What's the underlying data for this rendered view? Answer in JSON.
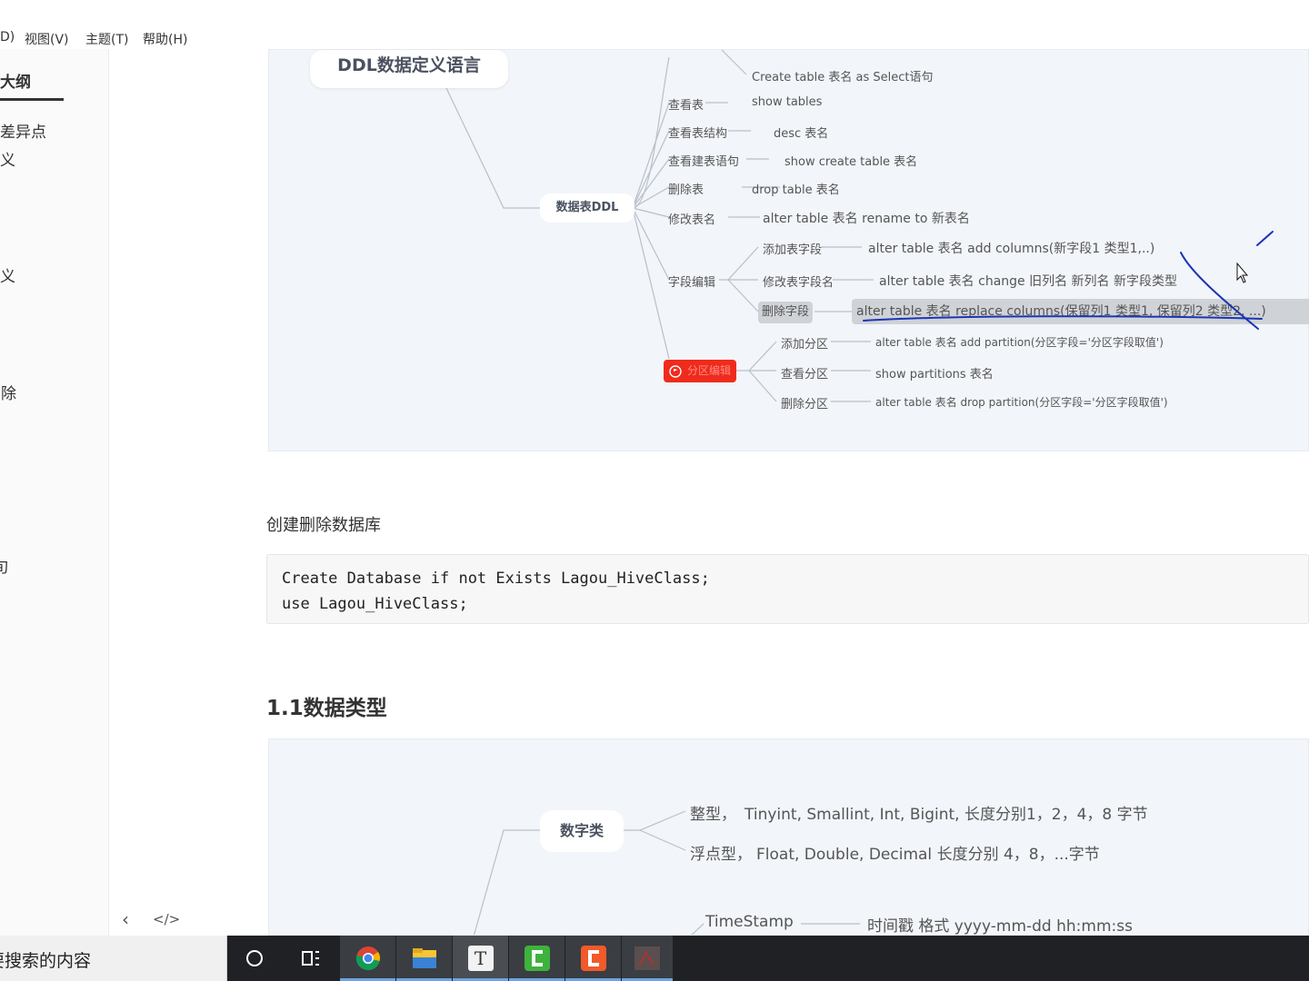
{
  "menu": {
    "items": [
      "D)",
      "视图(V)",
      "主题(T)",
      "帮助(H)"
    ]
  },
  "sidebar": {
    "outline_tab": "大纲",
    "items": [
      "差异点",
      "义",
      "定义",
      "删除",
      "旬"
    ],
    "prev_label": "‹",
    "source_label": "</>"
  },
  "search": {
    "placeholder": "要搜索的内容"
  },
  "taskbar": {
    "icons": [
      "cortana-icon",
      "task-view-icon",
      "chrome-icon",
      "file-explorer-icon",
      "typora-icon",
      "camtasia-green-icon",
      "camtasia-orange-icon",
      "app-thumbnail-icon"
    ],
    "typora_letter": "T"
  },
  "mindmap1": {
    "root": "DDL数据定义语言",
    "branch": "数据表DDL",
    "top_leaf": "Create table  表名  as  Select语句",
    "rows": [
      {
        "label": "查看表",
        "value": "show  tables"
      },
      {
        "label": "查看表结构",
        "value": "desc  表名"
      },
      {
        "label": "查看建表语句",
        "value": "show create table 表名"
      },
      {
        "label": "删除表",
        "value": "drop  table  表名"
      },
      {
        "label": "修改表名",
        "value": "alter table 表名 rename to 新表名"
      }
    ],
    "field_edit": {
      "label": "字段编辑",
      "children": [
        {
          "label": "添加表字段",
          "value": "alter table 表名 add  columns(新字段1  类型1,..)"
        },
        {
          "label": "修改表字段名",
          "value": "alter table 表名 change 旧列名  新列名 新字段类型"
        },
        {
          "label": "删除字段",
          "value": "alter table   表名  replace columns(保留列1 类型1,   保留列2 类型2,   ...)"
        }
      ]
    },
    "partition": {
      "label": "分区编辑",
      "children": [
        {
          "label": "添加分区",
          "value": "alter table 表名 add  partition(分区字段='分区字段取值')"
        },
        {
          "label": "查看分区",
          "value": "show partitions  表名"
        },
        {
          "label": "删除分区",
          "value": "alter table 表名 drop  partition(分区字段='分区字段取值')"
        }
      ]
    }
  },
  "section_heading": "创建删除数据库",
  "code": {
    "line1": "Create Database if not Exists Lagou_HiveClass;",
    "line2": "use Lagou_HiveClass;"
  },
  "heading_1_1": "1.1数据类型",
  "mindmap2": {
    "branch": "数字类",
    "int_label": "整型，",
    "int_value": "Tinyint, Smallint, Int, Bigint, 长度分别1，2，4，8 字节",
    "float_label": "浮点型，",
    "float_value": "Float, Double, Decimal  长度分别 4，8，...字节",
    "ts_label": "TimeStamp",
    "ts_value": "时间戳  格式 yyyy-mm-dd hh:mm:ss"
  },
  "colors": {
    "annotation": "#1a35b5",
    "partition_node": "#ef2b1d",
    "selected_node": "#cfd2d6"
  }
}
